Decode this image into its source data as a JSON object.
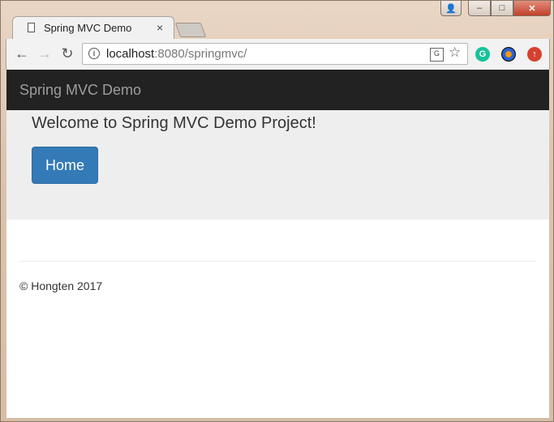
{
  "browser": {
    "tab_title": "Spring MVC Demo",
    "tab_close": "×",
    "url_host": "localhost",
    "url_rest": ":8080/springmvc/",
    "controls": {
      "minimize": "–",
      "maximize": "□",
      "close": "✕"
    }
  },
  "page": {
    "brand": "Spring MVC Demo",
    "welcome": "Welcome to Spring MVC Demo Project!",
    "home_button": "Home",
    "footer": "© Hongten 2017"
  },
  "colors": {
    "navbar": "#222222",
    "brand_text": "#9d9d9d",
    "jumbotron": "#eeeeee",
    "primary_button": "#337ab7"
  }
}
